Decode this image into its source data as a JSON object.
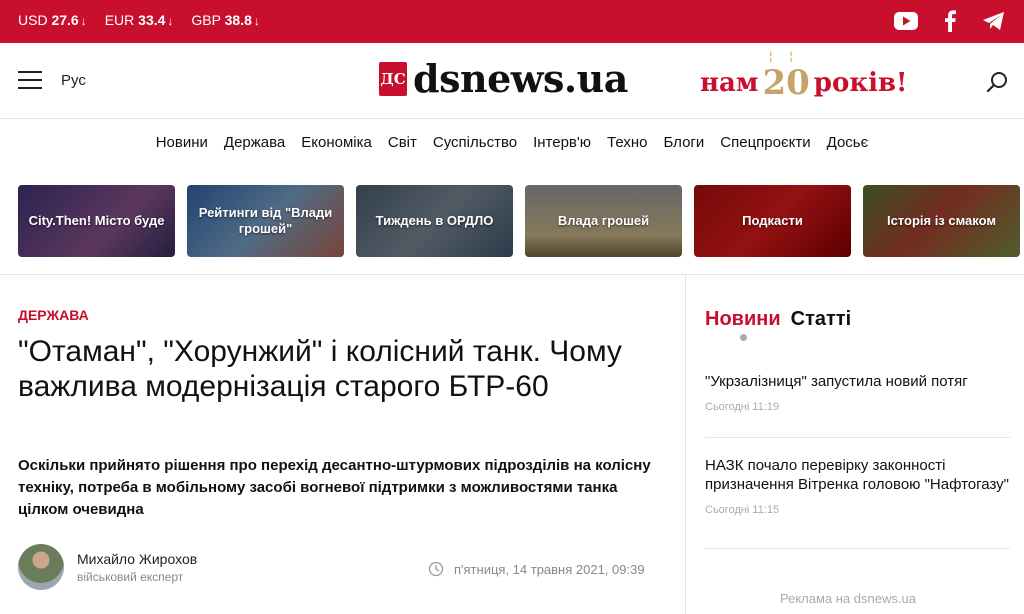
{
  "rates": [
    {
      "currency": "USD",
      "value": "27.6",
      "trend": "↓"
    },
    {
      "currency": "EUR",
      "value": "33.4",
      "trend": "↓"
    },
    {
      "currency": "GBP",
      "value": "38.8",
      "trend": "↓"
    }
  ],
  "social": [
    "youtube-icon",
    "facebook-icon",
    "telegram-icon"
  ],
  "header": {
    "lang": "Рус",
    "logo_badge": "ДС",
    "logo_text": "dsnews.ua",
    "anniv_pre": "нам",
    "anniv_num": "20",
    "anniv_post": "років!"
  },
  "nav": [
    "Новини",
    "Держава",
    "Економіка",
    "Світ",
    "Суспільство",
    "Інтерв'ю",
    "Техно",
    "Блоги",
    "Спецпроєкти",
    "Досьє"
  ],
  "tiles": [
    "City.Then! Місто буде",
    "Рейтинги від \"Влади грошей\"",
    "Тиждень в ОРДЛО",
    "Влада грошей",
    "Подкасти",
    "Історія із смаком"
  ],
  "article": {
    "category": "ДЕРЖАВА",
    "title": "\"Отаман\", \"Хорунжий\" і колісний танк. Чому важлива модернізація старого БТР-60",
    "lead": "Оскільки прийнято рішення про перехід десантно-штурмових підрозділів на колісну техніку, потреба в мобільному засобі вогневої підтримки з можливостями танка цілком очевидна",
    "author_name": "Михайло Жирохов",
    "author_role": "військовий експерт",
    "date": "п'ятниця, 14 травня 2021, 09:39"
  },
  "sidebar": {
    "tab_news": "Новини",
    "tab_articles": "Статті",
    "items": [
      {
        "title": "\"Укрзалізниця\" запустила новий потяг",
        "time": "Сьогодні 11:19"
      },
      {
        "title": "НАЗК почало перевірку законності призначення Вітренка головою \"Нафтогазу\"",
        "time": "Сьогодні 11:15"
      }
    ],
    "ad": "Реклама на dsnews.ua"
  },
  "colors": {
    "brand": "#c8102e"
  }
}
